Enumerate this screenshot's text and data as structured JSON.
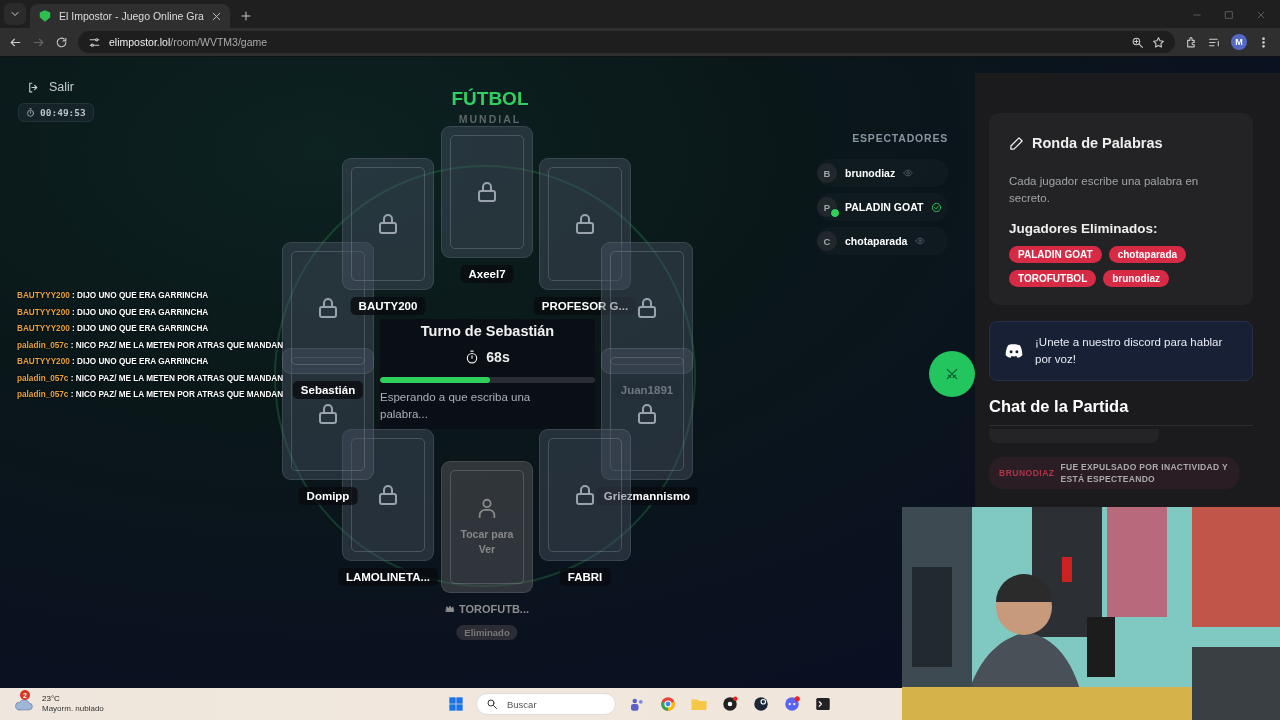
{
  "browser": {
    "tab_title": "El Impostor - Juego Online Gra",
    "url_host": "elimpostor.lol",
    "url_path": "/room/WVTM3/game",
    "profile_initial": "M"
  },
  "top_left": {
    "exit_label": "Salir",
    "elapsed": "00:49:53"
  },
  "stream_chat": [
    {
      "user": "BAUTYYY200",
      "message": ": DIJO UNO QUE ERA GARRINCHA"
    },
    {
      "user": "BAUTYYY200",
      "message": ": DIJO UNO QUE ERA GARRINCHA"
    },
    {
      "user": "BAUTYYY200",
      "message": ": DIJO UNO QUE ERA GARRINCHA"
    },
    {
      "user": "paladin_057c",
      "message": ": NICO PAZ/ ME LA METEN POR ATRAS QUE MANDAN"
    },
    {
      "user": "BAUTYYY200",
      "message": ": DIJO UNO QUE ERA GARRINCHA"
    },
    {
      "user": "paladin_057c",
      "message": ": NICO PAZ/ ME LA METEN POR ATRAS QUE MANDAN"
    },
    {
      "user": "paladin_057c",
      "message": ": NICO PAZ/ ME LA METEN POR ATRAS QUE MANDAN"
    }
  ],
  "game": {
    "category": "FÚTBOL",
    "subcategory": "MUNDIAL",
    "turn": "Turno de Sebastián",
    "timer": "68s",
    "level": 0.51,
    "status": "Esperando a que escriba una palabra...",
    "players": [
      {
        "name": "Axeel7",
        "kind": "locked",
        "faded": false,
        "crown": false
      },
      {
        "name": "PROFESOR G...",
        "kind": "locked",
        "faded": false,
        "crown": false
      },
      {
        "name": "Juan1891",
        "kind": "locked",
        "faded": true,
        "crown": false
      },
      {
        "name": "Griezmannismo",
        "kind": "locked",
        "faded": false,
        "crown": false
      },
      {
        "name": "FABRI",
        "kind": "locked",
        "faded": false,
        "crown": false
      },
      {
        "name": "TOROFUTB...",
        "kind": "eliminated",
        "faded": false,
        "crown": true,
        "reveal_hint": "Tocar para Ver",
        "badge": "Eliminado"
      },
      {
        "name": "LAMOLINETA...",
        "kind": "locked",
        "faded": false,
        "crown": false
      },
      {
        "name": "Domipp",
        "kind": "locked",
        "faded": false,
        "crown": false
      },
      {
        "name": "Sebastián",
        "kind": "locked",
        "faded": false,
        "crown": false
      },
      {
        "name": "BAUTY200",
        "kind": "locked",
        "faded": false,
        "crown": false
      }
    ]
  },
  "spectators": {
    "title": "ESPECTADORES",
    "items": [
      {
        "initial": "B",
        "name": "brunodiaz",
        "ready": false
      },
      {
        "initial": "P",
        "name": "PALADIN GOAT",
        "ready": true
      },
      {
        "initial": "C",
        "name": "chotaparada",
        "ready": false
      }
    ]
  },
  "panel": {
    "round": {
      "title": "Ronda de Palabras",
      "description": "Cada jugador escribe una palabra en secreto.",
      "eliminated_heading": "Jugadores Eliminados:",
      "eliminated": [
        "PALADIN GOAT",
        "chotaparada",
        "TOROFUTBOL",
        "brunodiaz"
      ]
    },
    "discord": {
      "text": "¡Unete a nuestro discord para hablar por voz!"
    },
    "chat": {
      "title": "Chat de la Partida",
      "messages": [
        {
          "kind": "system",
          "user": "BRUNODIAZ",
          "text": "FUE EXPULSADO POR INACTIVIDAD Y ESTÁ ESPECTEANDO"
        }
      ]
    }
  },
  "taskbar": {
    "weather_badge": "2",
    "temperature": "23°C",
    "condition": "Mayorm. nublado",
    "search_placeholder": "Buscar"
  }
}
